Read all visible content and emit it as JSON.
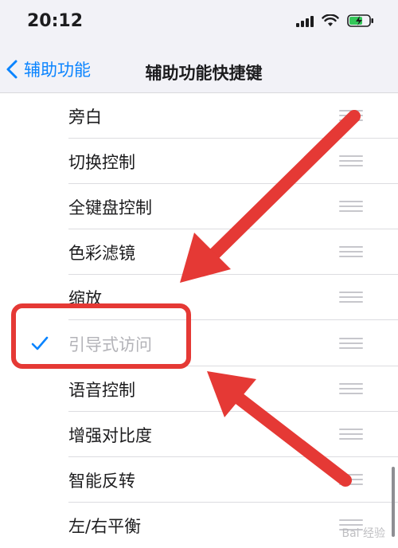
{
  "status": {
    "time": "20:12"
  },
  "nav": {
    "back_label": "辅助功能",
    "title": "辅助功能快捷键"
  },
  "list": {
    "items": [
      {
        "label": "旁白",
        "checked": false,
        "disabled": false
      },
      {
        "label": "切换控制",
        "checked": false,
        "disabled": false
      },
      {
        "label": "全键盘控制",
        "checked": false,
        "disabled": false
      },
      {
        "label": "色彩滤镜",
        "checked": false,
        "disabled": false
      },
      {
        "label": "缩放",
        "checked": false,
        "disabled": false
      },
      {
        "label": "引导式访问",
        "checked": true,
        "disabled": true
      },
      {
        "label": "语音控制",
        "checked": false,
        "disabled": false
      },
      {
        "label": "增强对比度",
        "checked": false,
        "disabled": false
      },
      {
        "label": "智能反转",
        "checked": false,
        "disabled": false
      },
      {
        "label": "左/右平衡",
        "checked": false,
        "disabled": false
      }
    ]
  },
  "colors": {
    "accent": "#0a84ff",
    "annotation": "#e53935",
    "battery": "#34c759"
  },
  "watermark": "Bai 经验"
}
